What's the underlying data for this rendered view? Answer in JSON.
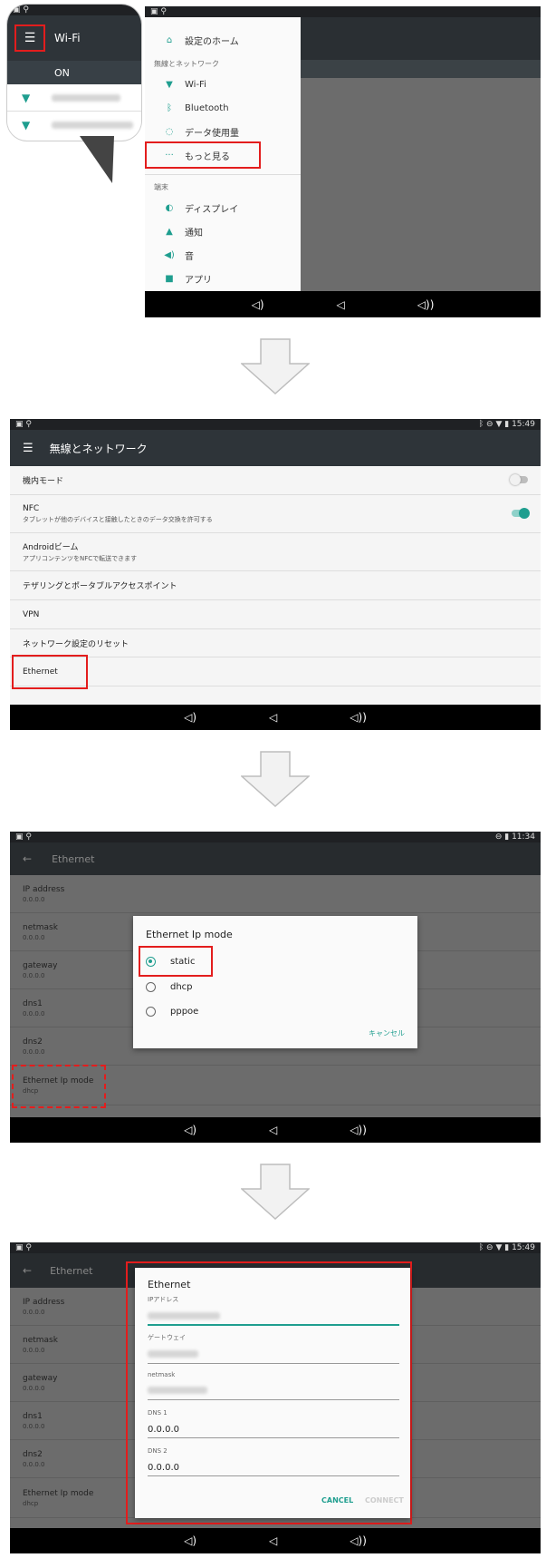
{
  "panel1": {
    "bubble": {
      "title": "Wi-Fi",
      "toggle": "ON"
    },
    "drawer": {
      "home": "設定のホーム",
      "section_wireless": "無線とネットワーク",
      "items": [
        {
          "label": "Wi-Fi",
          "icon": "wifi-icon"
        },
        {
          "label": "Bluetooth",
          "icon": "bluetooth-icon"
        },
        {
          "label": "データ使用量",
          "icon": "data-usage-icon"
        },
        {
          "label": "もっと見る",
          "icon": "more-icon"
        }
      ],
      "section_device": "端末",
      "device_items": [
        {
          "label": "ディスプレイ",
          "icon": "display-icon"
        },
        {
          "label": "通知",
          "icon": "bell-icon"
        },
        {
          "label": "音",
          "icon": "volume-icon"
        },
        {
          "label": "アプリ",
          "icon": "apps-icon"
        }
      ]
    }
  },
  "panel2": {
    "status_time": "15:49",
    "title": "無線とネットワーク",
    "rows": [
      {
        "title": "機内モード",
        "subtitle": ""
      },
      {
        "title": "NFC",
        "subtitle": "タブレットが他のデバイスと接触したときのデータ交換を許可する"
      },
      {
        "title": "Androidビーム",
        "subtitle": "アプリコンテンツをNFCで転送できます"
      },
      {
        "title": "テザリングとポータブルアクセスポイント",
        "subtitle": ""
      },
      {
        "title": "VPN",
        "subtitle": ""
      },
      {
        "title": "ネットワーク設定のリセット",
        "subtitle": ""
      },
      {
        "title": "Ethernet",
        "subtitle": ""
      }
    ],
    "toggles": {
      "airplane": false,
      "nfc": true
    }
  },
  "panel3": {
    "status_time": "11:34",
    "title": "Ethernet",
    "rows": [
      {
        "title": "IP address",
        "value": "0.0.0.0"
      },
      {
        "title": "netmask",
        "value": "0.0.0.0"
      },
      {
        "title": "gateway",
        "value": "0.0.0.0"
      },
      {
        "title": "dns1",
        "value": "0.0.0.0"
      },
      {
        "title": "dns2",
        "value": "0.0.0.0"
      },
      {
        "title": "Ethernet Ip mode",
        "value": "dhcp"
      }
    ],
    "dialog": {
      "title": "Ethernet Ip mode",
      "options": [
        "static",
        "dhcp",
        "pppoe"
      ],
      "selected": "static",
      "cancel": "キャンセル"
    }
  },
  "panel4": {
    "status_time": "15:49",
    "title": "Ethernet",
    "rows": [
      {
        "title": "IP address",
        "value": "0.0.0.0"
      },
      {
        "title": "netmask",
        "value": "0.0.0.0"
      },
      {
        "title": "gateway",
        "value": "0.0.0.0"
      },
      {
        "title": "dns1",
        "value": "0.0.0.0"
      },
      {
        "title": "dns2",
        "value": "0.0.0.0"
      },
      {
        "title": "Ethernet Ip mode",
        "value": "dhcp"
      }
    ],
    "dialog": {
      "title": "Ethernet",
      "fields": [
        {
          "label": "IPアドレス",
          "value": ""
        },
        {
          "label": "ゲートウェイ",
          "value": ""
        },
        {
          "label": "netmask",
          "value": ""
        },
        {
          "label": "DNS 1",
          "value": "0.0.0.0"
        },
        {
          "label": "DNS 2",
          "value": "0.0.0.0"
        }
      ],
      "cancel": "CANCEL",
      "connect": "CONNECT"
    }
  },
  "colors": {
    "accent": "#1f9e8f",
    "highlight": "#e31d1d",
    "toolbar": "#2e3439"
  }
}
